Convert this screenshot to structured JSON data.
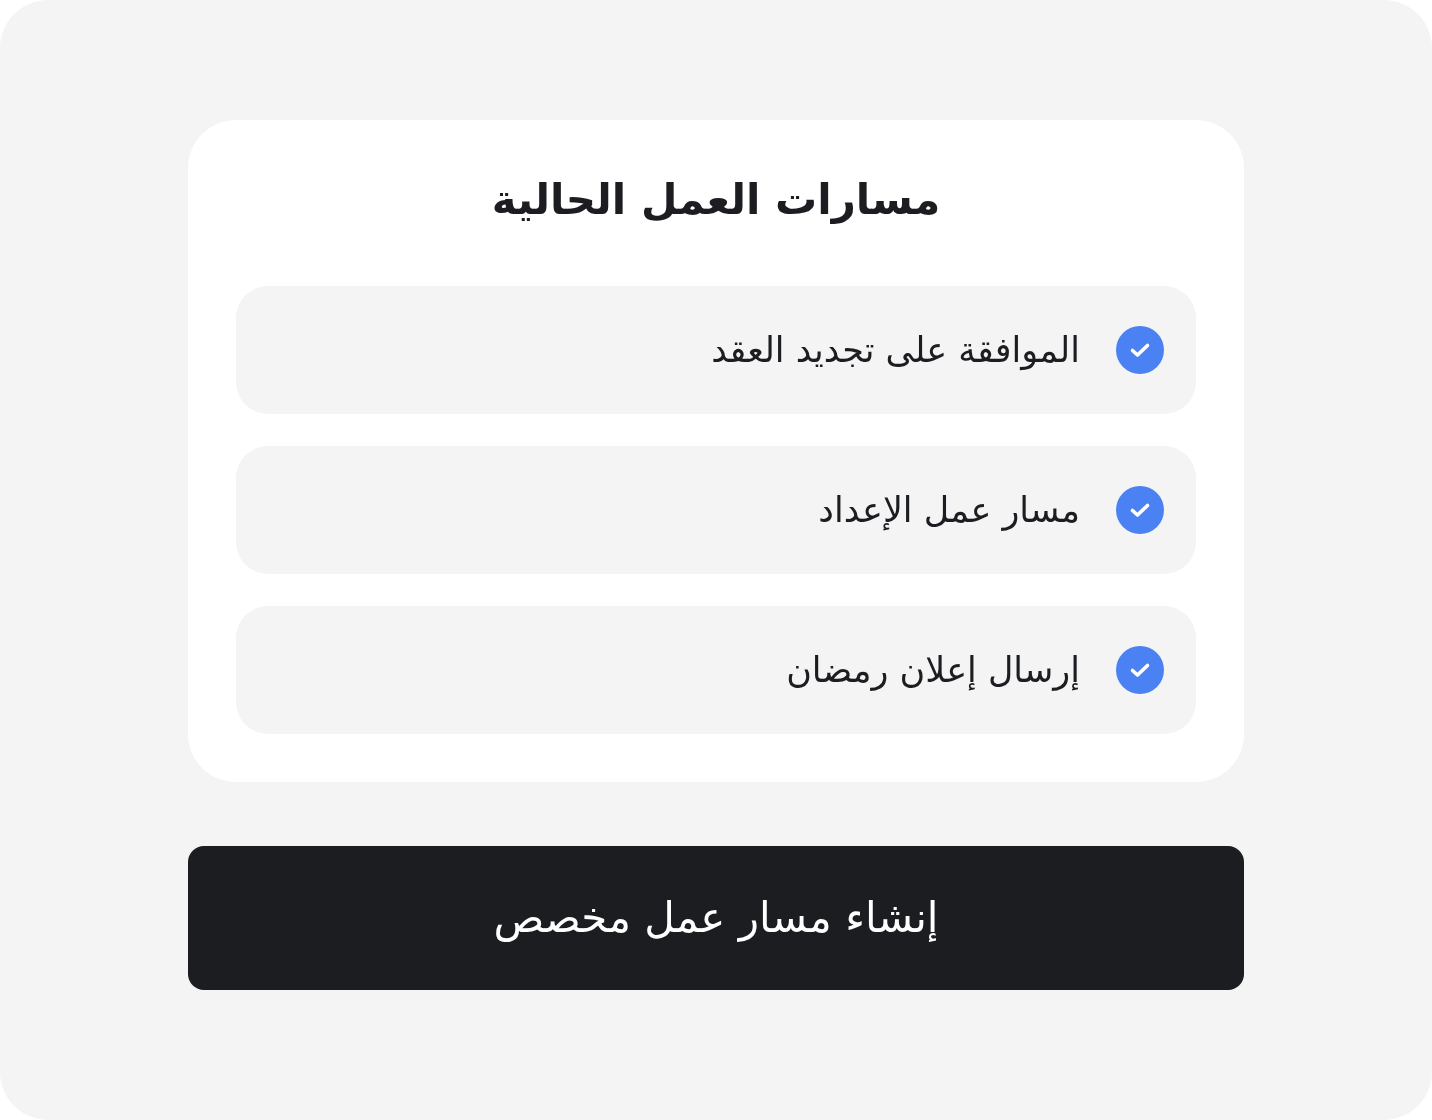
{
  "card": {
    "title": "مسارات العمل الحالية",
    "workflows": [
      {
        "label": "الموافقة على تجديد العقد",
        "checked": true
      },
      {
        "label": "مسار عمل الإعداد",
        "checked": true
      },
      {
        "label": "إرسال إعلان رمضان",
        "checked": true
      }
    ]
  },
  "create_button": {
    "label": "إنشاء مسار عمل مخصص"
  }
}
